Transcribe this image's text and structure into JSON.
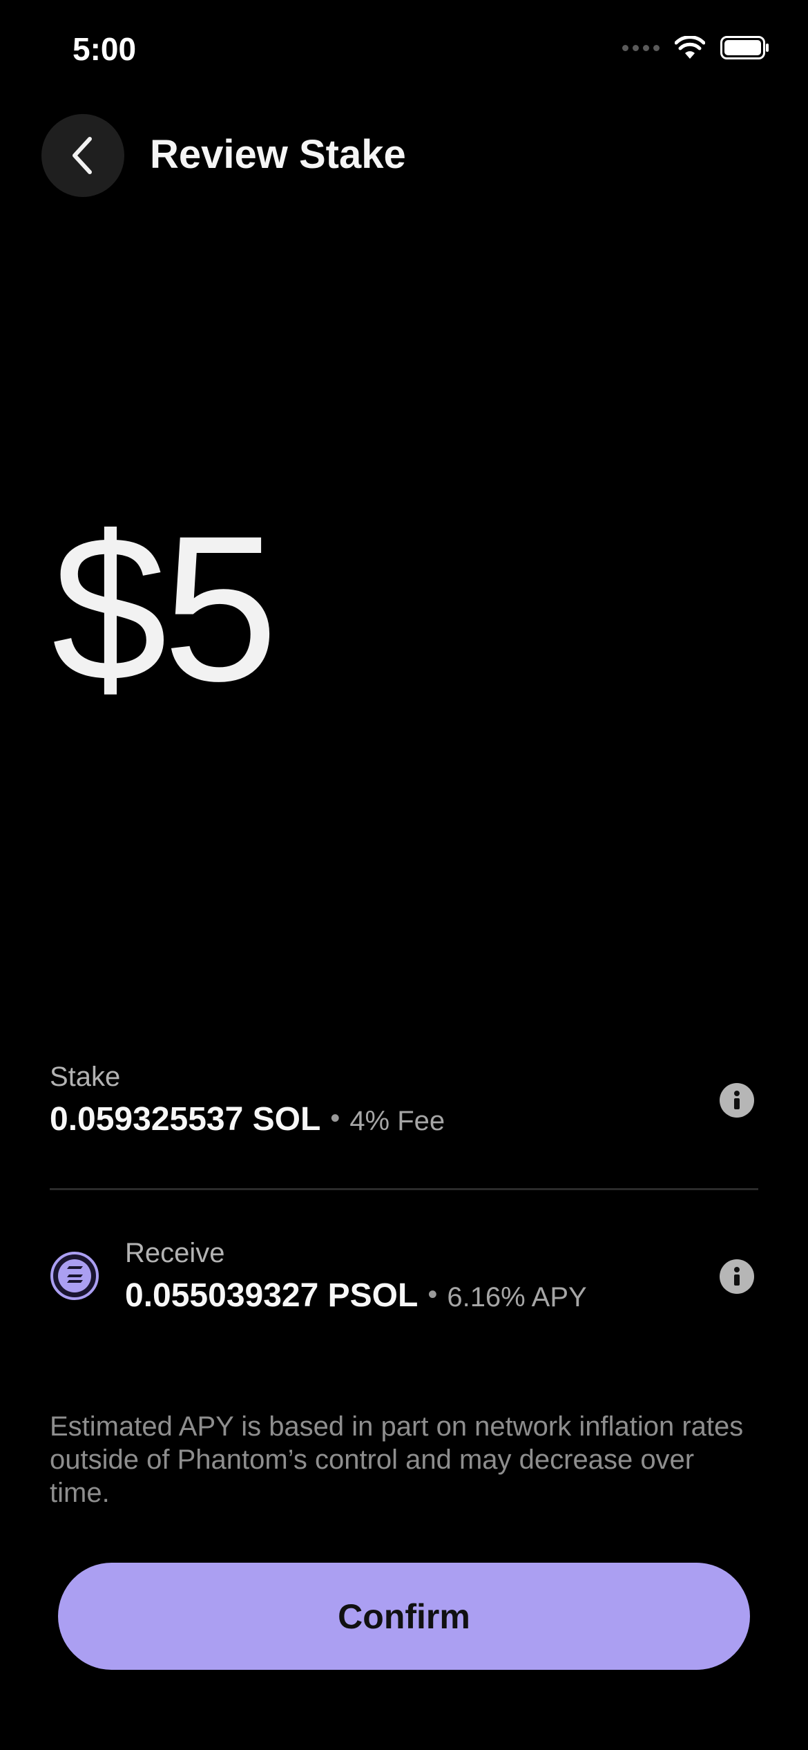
{
  "status_bar": {
    "time": "5:00"
  },
  "header": {
    "title": "Review Stake",
    "back_icon": "chevron-left-icon"
  },
  "amount": {
    "value": "$5"
  },
  "stake": {
    "label": "Stake",
    "value": "0.059325537 SOL",
    "separator": "•",
    "extra": "4% Fee",
    "info_icon": "info-icon"
  },
  "receive": {
    "label": "Receive",
    "value": "0.055039327 PSOL",
    "separator": "•",
    "extra": "6.16% APY",
    "token_icon": "psol-token-icon",
    "info_icon": "info-icon"
  },
  "disclaimer": "Estimated APY is based in part on network inflation rates outside of Phantom’s control and may decrease over time.",
  "confirm_button": {
    "label": "Confirm"
  },
  "colors": {
    "background": "#000000",
    "accent": "#ab9ff2",
    "token_icon": "#ab9ff2"
  }
}
